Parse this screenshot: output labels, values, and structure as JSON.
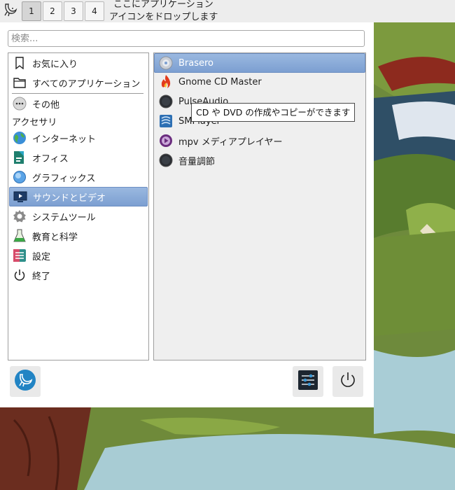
{
  "panel": {
    "workspaces": [
      "1",
      "2",
      "3",
      "4"
    ],
    "active_workspace": "1",
    "drop_hint_line1": "ここにアプリケーション",
    "drop_hint_line2": "アイコンをドロップします"
  },
  "menu": {
    "search_placeholder": "検索...",
    "search_value": "",
    "top_items": [
      {
        "label": "お気に入り",
        "icon": "bookmark-icon"
      },
      {
        "label": "すべてのアプリケーション",
        "icon": "folder-icon"
      }
    ],
    "other_label": "その他",
    "section_label": "アクセサリ",
    "categories": [
      {
        "label": "インターネット",
        "icon": "globe-icon"
      },
      {
        "label": "オフィス",
        "icon": "office-icon"
      },
      {
        "label": "グラフィックス",
        "icon": "graphics-icon"
      },
      {
        "label": "サウンドとビデオ",
        "icon": "multimedia-icon",
        "selected": true
      },
      {
        "label": "システムツール",
        "icon": "gear-icon"
      },
      {
        "label": "教育と科学",
        "icon": "flask-icon"
      },
      {
        "label": "設定",
        "icon": "settings-icon"
      },
      {
        "label": "終了",
        "icon": "power-icon"
      }
    ],
    "apps": [
      {
        "label": "Brasero",
        "icon": "disc-icon",
        "selected": true
      },
      {
        "label": "Gnome CD Master",
        "icon": "flame-icon"
      },
      {
        "label": "PulseAudio",
        "icon": "volume-icon"
      },
      {
        "label": "SMPlayer",
        "icon": "smplayer-icon"
      },
      {
        "label": "mpv メディアプレイヤー",
        "icon": "mpv-icon"
      },
      {
        "label": "音量調節",
        "icon": "volume-icon"
      }
    ],
    "tooltip": "CD や DVD の作成やコピーができます"
  },
  "colors": {
    "selection": "#7c9fd1",
    "panel_bg": "#ededed",
    "app_pane_bg": "#efefef"
  }
}
